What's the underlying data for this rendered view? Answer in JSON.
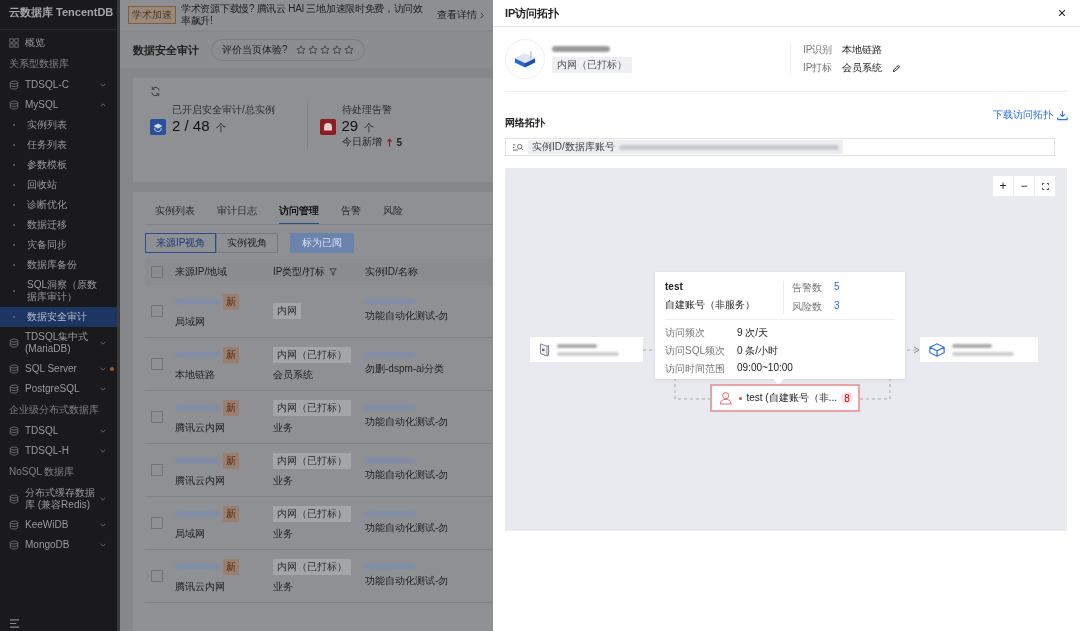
{
  "sidebar": {
    "brand": "云数据库 TencentDB",
    "items": [
      {
        "kind": "link",
        "label": "概览",
        "selected": false
      },
      {
        "kind": "section",
        "label": "关系型数据库"
      },
      {
        "kind": "group",
        "label": "TDSQL-C",
        "expanded": false,
        "alert": false
      },
      {
        "kind": "group",
        "label": "MySQL",
        "expanded": true,
        "alert": false,
        "children": [
          {
            "label": "实例列表",
            "selected": false
          },
          {
            "label": "任务列表",
            "selected": false
          },
          {
            "label": "参数模板",
            "selected": false
          },
          {
            "label": "回收站",
            "selected": false
          },
          {
            "label": "诊断优化",
            "selected": false
          },
          {
            "label": "数据迁移",
            "selected": false
          },
          {
            "label": "灾备同步",
            "selected": false
          },
          {
            "label": "数据库备份",
            "selected": false
          },
          {
            "label": "SQL洞察（原数据库审计）",
            "selected": false
          },
          {
            "label": "数据安全审计",
            "selected": true
          }
        ]
      },
      {
        "kind": "group",
        "label": "TDSQL集中式 (MariaDB)",
        "expanded": false,
        "alert": false
      },
      {
        "kind": "group",
        "label": "SQL Server",
        "expanded": false,
        "alert": true
      },
      {
        "kind": "group",
        "label": "PostgreSQL",
        "expanded": false,
        "alert": false
      },
      {
        "kind": "section",
        "label": "企业级分布式数据库"
      },
      {
        "kind": "group",
        "label": "TDSQL",
        "expanded": false,
        "alert": false
      },
      {
        "kind": "group",
        "label": "TDSQL-H",
        "expanded": false,
        "alert": false
      },
      {
        "kind": "section",
        "label": "NoSQL 数据库"
      },
      {
        "kind": "group",
        "label": "分布式缓存数据库 (兼容Redis)",
        "expanded": false,
        "alert": false
      },
      {
        "kind": "group",
        "label": "KeeWiDB",
        "expanded": false,
        "alert": false
      },
      {
        "kind": "group",
        "label": "MongoDB",
        "expanded": false,
        "alert": false
      }
    ]
  },
  "banner": {
    "tag": "学术加速",
    "text": "学术资源下载慢? 腾讯云 HAI 三地加速限时免费，访问效率飙升!",
    "link": "查看详情"
  },
  "page_title": "数据安全审计",
  "rating": {
    "label": "评价当页体验?",
    "stars": 0
  },
  "stats": [
    {
      "kind": "audit",
      "label": "已开启安全审计/总实例",
      "value": "2 / 48",
      "unit": "个"
    },
    {
      "kind": "alarm",
      "label": "待处理告警",
      "value": "29",
      "unit": "个",
      "today_label": "今日新增",
      "today_value": "5"
    }
  ],
  "tabs": [
    {
      "label": "实例列表",
      "selected": false
    },
    {
      "label": "审计日志",
      "selected": false
    },
    {
      "label": "访问管理",
      "selected": true
    },
    {
      "label": "告警",
      "selected": false
    },
    {
      "label": "风险",
      "selected": false
    }
  ],
  "view_toggle": [
    {
      "label": "来源IP视角",
      "selected": true
    },
    {
      "label": "实例视角",
      "selected": false
    }
  ],
  "action_button": {
    "label": "标为已阅",
    "disabled": true
  },
  "table": {
    "header_checked": false,
    "columns": [
      "来源IP/地域",
      "IP类型/打标",
      "实例ID/名称"
    ],
    "rows": [
      {
        "checked": false,
        "badge": "新",
        "region": "局域网",
        "ip_type": "内网",
        "ip_mark": "",
        "instance_name": "功能自动化测试-勿"
      },
      {
        "checked": false,
        "badge": "新",
        "region": "本地链路",
        "ip_type": "内网（已打标）",
        "ip_mark": "会员系统",
        "instance_name": "勿删-dspm-ai分类"
      },
      {
        "checked": false,
        "badge": "新",
        "region": "腾讯云内网",
        "ip_type": "内网（已打标）",
        "ip_mark": "业务",
        "instance_name": "功能自动化测试-勿"
      },
      {
        "checked": false,
        "badge": "新",
        "region": "腾讯云内网",
        "ip_type": "内网（已打标）",
        "ip_mark": "业务",
        "instance_name": "功能自动化测试-勿"
      },
      {
        "checked": false,
        "badge": "新",
        "region": "局域网",
        "ip_type": "内网（已打标）",
        "ip_mark": "业务",
        "instance_name": "功能自动化测试-勿"
      },
      {
        "checked": false,
        "badge": "新",
        "region": "腾讯云内网",
        "ip_type": "内网（已打标）",
        "ip_mark": "业务",
        "instance_name": "功能自动化测试-勿"
      }
    ]
  },
  "drawer": {
    "title": "IP访问拓扑",
    "ip_tag": "内网（已打标）",
    "info": [
      {
        "label": "IP识别",
        "value": "本地链路",
        "editable": false
      },
      {
        "label": "IP打标",
        "value": "会员系统",
        "editable": true
      }
    ],
    "section_title": "网络拓扑",
    "download_link": "下载访问拓扑",
    "filter_chip": "实例ID/数据库账号",
    "zoom_controls": [
      "+",
      "−"
    ],
    "popover": {
      "account": "test",
      "account_type": "自建账号（非服务）",
      "stats": [
        {
          "label": "告警数",
          "value": "5"
        },
        {
          "label": "风险数",
          "value": "3"
        }
      ],
      "details": [
        {
          "label": "访问频次",
          "value": "9 次/天"
        },
        {
          "label": "访问SQL频次",
          "value": "0 条/小时"
        },
        {
          "label": "访问时间范围",
          "value": "09:00~10:00"
        }
      ]
    },
    "account_node": {
      "label": "test (自建账号（非...",
      "count": "8",
      "alert": true
    }
  }
}
